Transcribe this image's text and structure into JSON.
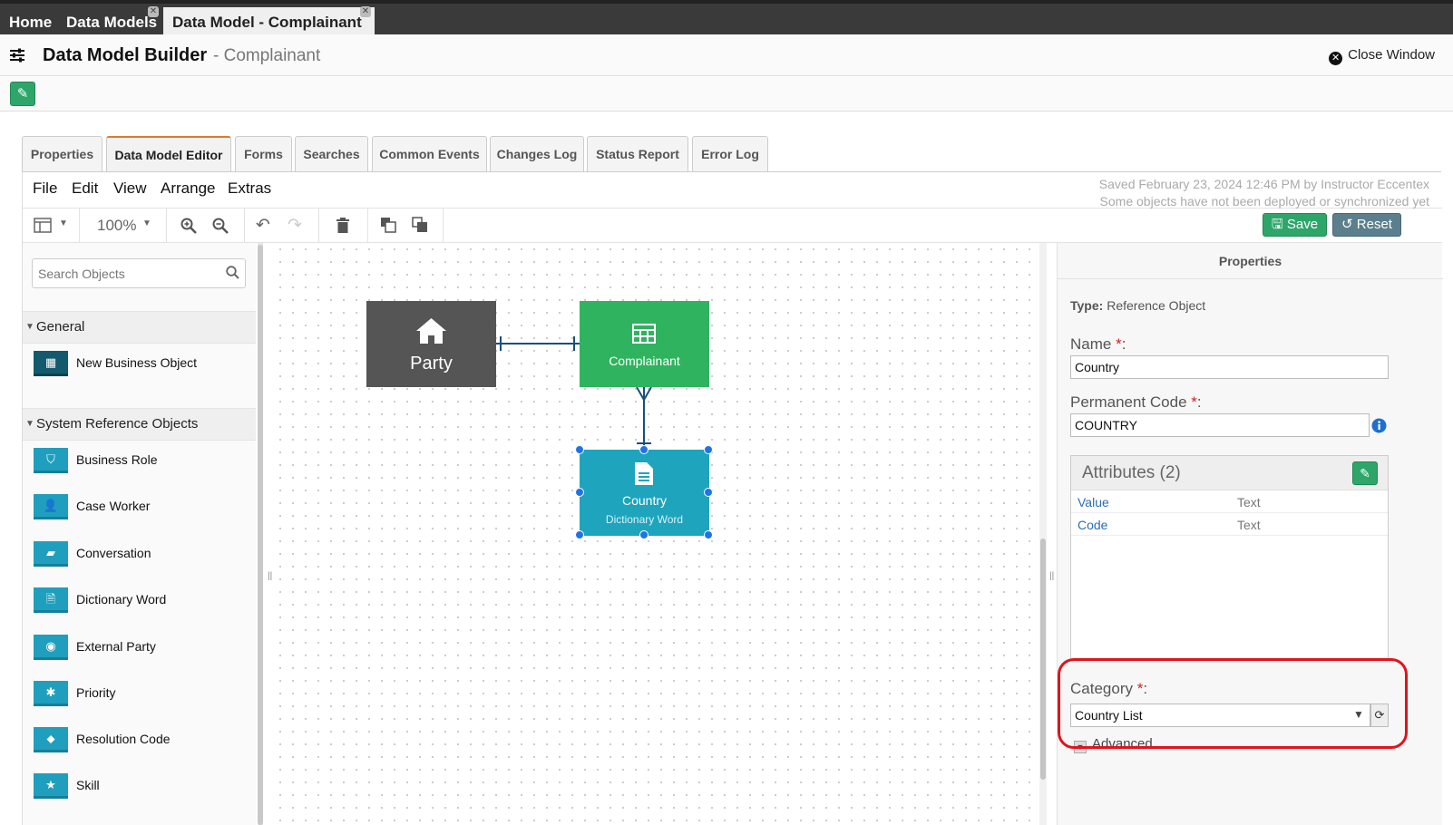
{
  "top_tabs": [
    {
      "label": "Home",
      "closable": false
    },
    {
      "label": "Data Models",
      "closable": true
    },
    {
      "label": "Data Model - Complainant",
      "closable": true,
      "active": true
    }
  ],
  "header": {
    "title": "Data Model Builder",
    "subtitle": "- Complainant",
    "close_label": "Close Window"
  },
  "tabs": [
    {
      "label": "Properties"
    },
    {
      "label": "Data Model Editor",
      "active": true
    },
    {
      "label": "Forms"
    },
    {
      "label": "Searches"
    },
    {
      "label": "Common Events"
    },
    {
      "label": "Changes Log"
    },
    {
      "label": "Status Report"
    },
    {
      "label": "Error Log"
    }
  ],
  "menu": [
    "File",
    "Edit",
    "View",
    "Arrange",
    "Extras"
  ],
  "status": {
    "saved": "Saved February 23, 2024 12:46 PM by Instructor Eccentex",
    "sync": "Some objects have not been deployed or synchronized yet"
  },
  "toolbar": {
    "zoom": "100%",
    "save_label": "Save",
    "reset_label": "Reset"
  },
  "sidebar": {
    "search_placeholder": "Search Objects",
    "general_label": "General",
    "general_items": [
      {
        "label": "New Business Object",
        "icon": "table-icon"
      }
    ],
    "system_label": "System Reference Objects",
    "system_items": [
      {
        "label": "Business Role",
        "icon": "shield-icon"
      },
      {
        "label": "Case Worker",
        "icon": "user-icon"
      },
      {
        "label": "Conversation",
        "icon": "chat-icon"
      },
      {
        "label": "Dictionary Word",
        "icon": "document-icon"
      },
      {
        "label": "External Party",
        "icon": "globe-icon"
      },
      {
        "label": "Priority",
        "icon": "asterisk-icon"
      },
      {
        "label": "Resolution Code",
        "icon": "tag-icon"
      },
      {
        "label": "Skill",
        "icon": "star-icon"
      }
    ]
  },
  "diagram": {
    "nodes": [
      {
        "id": "party",
        "label": "Party",
        "icon": "home-icon",
        "color": "#555555"
      },
      {
        "id": "complainant",
        "label": "Complainant",
        "icon": "table-icon",
        "color": "#2fb35f"
      },
      {
        "id": "country",
        "label": "Country",
        "sublabel": "Dictionary Word",
        "icon": "document-icon",
        "color": "#1ea4bd",
        "selected": true
      }
    ]
  },
  "properties": {
    "title": "Properties",
    "type_label": "Type:",
    "type_value": "Reference Object",
    "name_label": "Name",
    "name_value": "Country",
    "code_label": "Permanent Code",
    "code_value": "COUNTRY",
    "attributes_title": "Attributes (2)",
    "attributes": [
      {
        "name": "Value",
        "type": "Text"
      },
      {
        "name": "Code",
        "type": "Text"
      }
    ],
    "category_label": "Category",
    "category_value": "Country List",
    "advanced_label": "Advanced"
  },
  "colors": {
    "accent_green": "#2ea66a",
    "reset_gray": "#5b7f8d",
    "highlight_red": "#e0141c",
    "tab_accent": "#e07a2a"
  }
}
